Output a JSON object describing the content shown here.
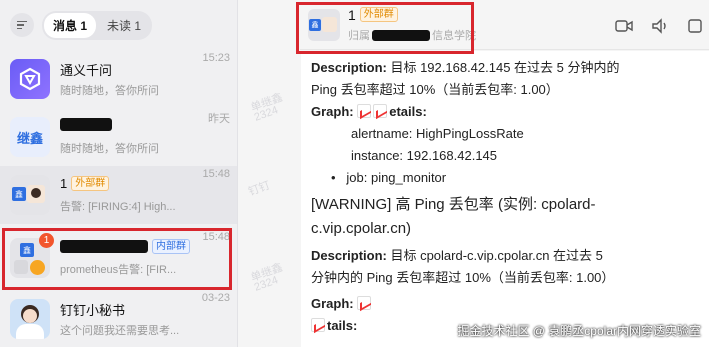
{
  "sidebar": {
    "tabs": [
      {
        "label": "消息 1",
        "active": true
      },
      {
        "label": "未读 1",
        "active": false
      }
    ],
    "conversations": [
      {
        "title": "通义千问",
        "preview": "随时随地，答你所问",
        "time": "15:23",
        "avatar": "tongyi-logo"
      },
      {
        "title": "",
        "preview": "随时随地，答你所问",
        "time": "昨天",
        "avatar_text": "继鑫",
        "title_redacted": true
      },
      {
        "title": "1",
        "tag": "外部群",
        "preview": "告警: [FIRING:4] High...",
        "time": "15:48",
        "avatar": "group-avatar"
      },
      {
        "title": "",
        "tag": "内部群",
        "preview": "prometheus告警: [FIR...",
        "time": "15:48",
        "badge": "1",
        "title_redacted": true
      },
      {
        "title": "钉钉小秘书",
        "preview": "这个问题我还需要思考...",
        "time": "03-23",
        "avatar": "assistant-avatar"
      }
    ],
    "group_avatar_label": "鑫"
  },
  "watermark": {
    "text_1": "单继鑫",
    "text_2": "2324",
    "text_3": "钉钉"
  },
  "header": {
    "title": "1",
    "tag": "外部群",
    "subtitle_prefix": "归属",
    "subtitle_suffix": "信息学院",
    "icons": [
      "video-call-icon",
      "voice-call-icon",
      "more-icon"
    ]
  },
  "message": {
    "desc1_label": "Description:",
    "desc1_text": "目标 192.168.42.145 在过去 5 分钟内的",
    "desc1_text2": "Ping 丢包率超过 10%（当前丢包率: 1.00）",
    "graph_label": "Graph:",
    "graph_suffix": "etails:",
    "alertname": "alertname: HighPingLossRate",
    "instance": "instance: 192.168.42.145",
    "job": "job: ping_monitor",
    "warning_line1": "[WARNING] 高 Ping 丢包率 (实例: cpolard-",
    "warning_line2": "c.vip.cpolar.cn)",
    "desc2_label": "Description:",
    "desc2_text": "目标 cpolard-c.vip.cpolar.cn 在过去 5",
    "desc2_text2": "分钟内的 Ping 丢包率超过 10%（当前丢包率: 1.00）",
    "graph2_label": "Graph:",
    "tails_label": "tails:"
  },
  "footer_watermark": "掘金技术社区 @ 袁鹏丞cpolar内网穿透实验室",
  "colors": {
    "highlight": "#d8262d",
    "external_tag": "#e08a00",
    "internal_tag": "#2f6fe0",
    "badge": "#f2552c"
  }
}
